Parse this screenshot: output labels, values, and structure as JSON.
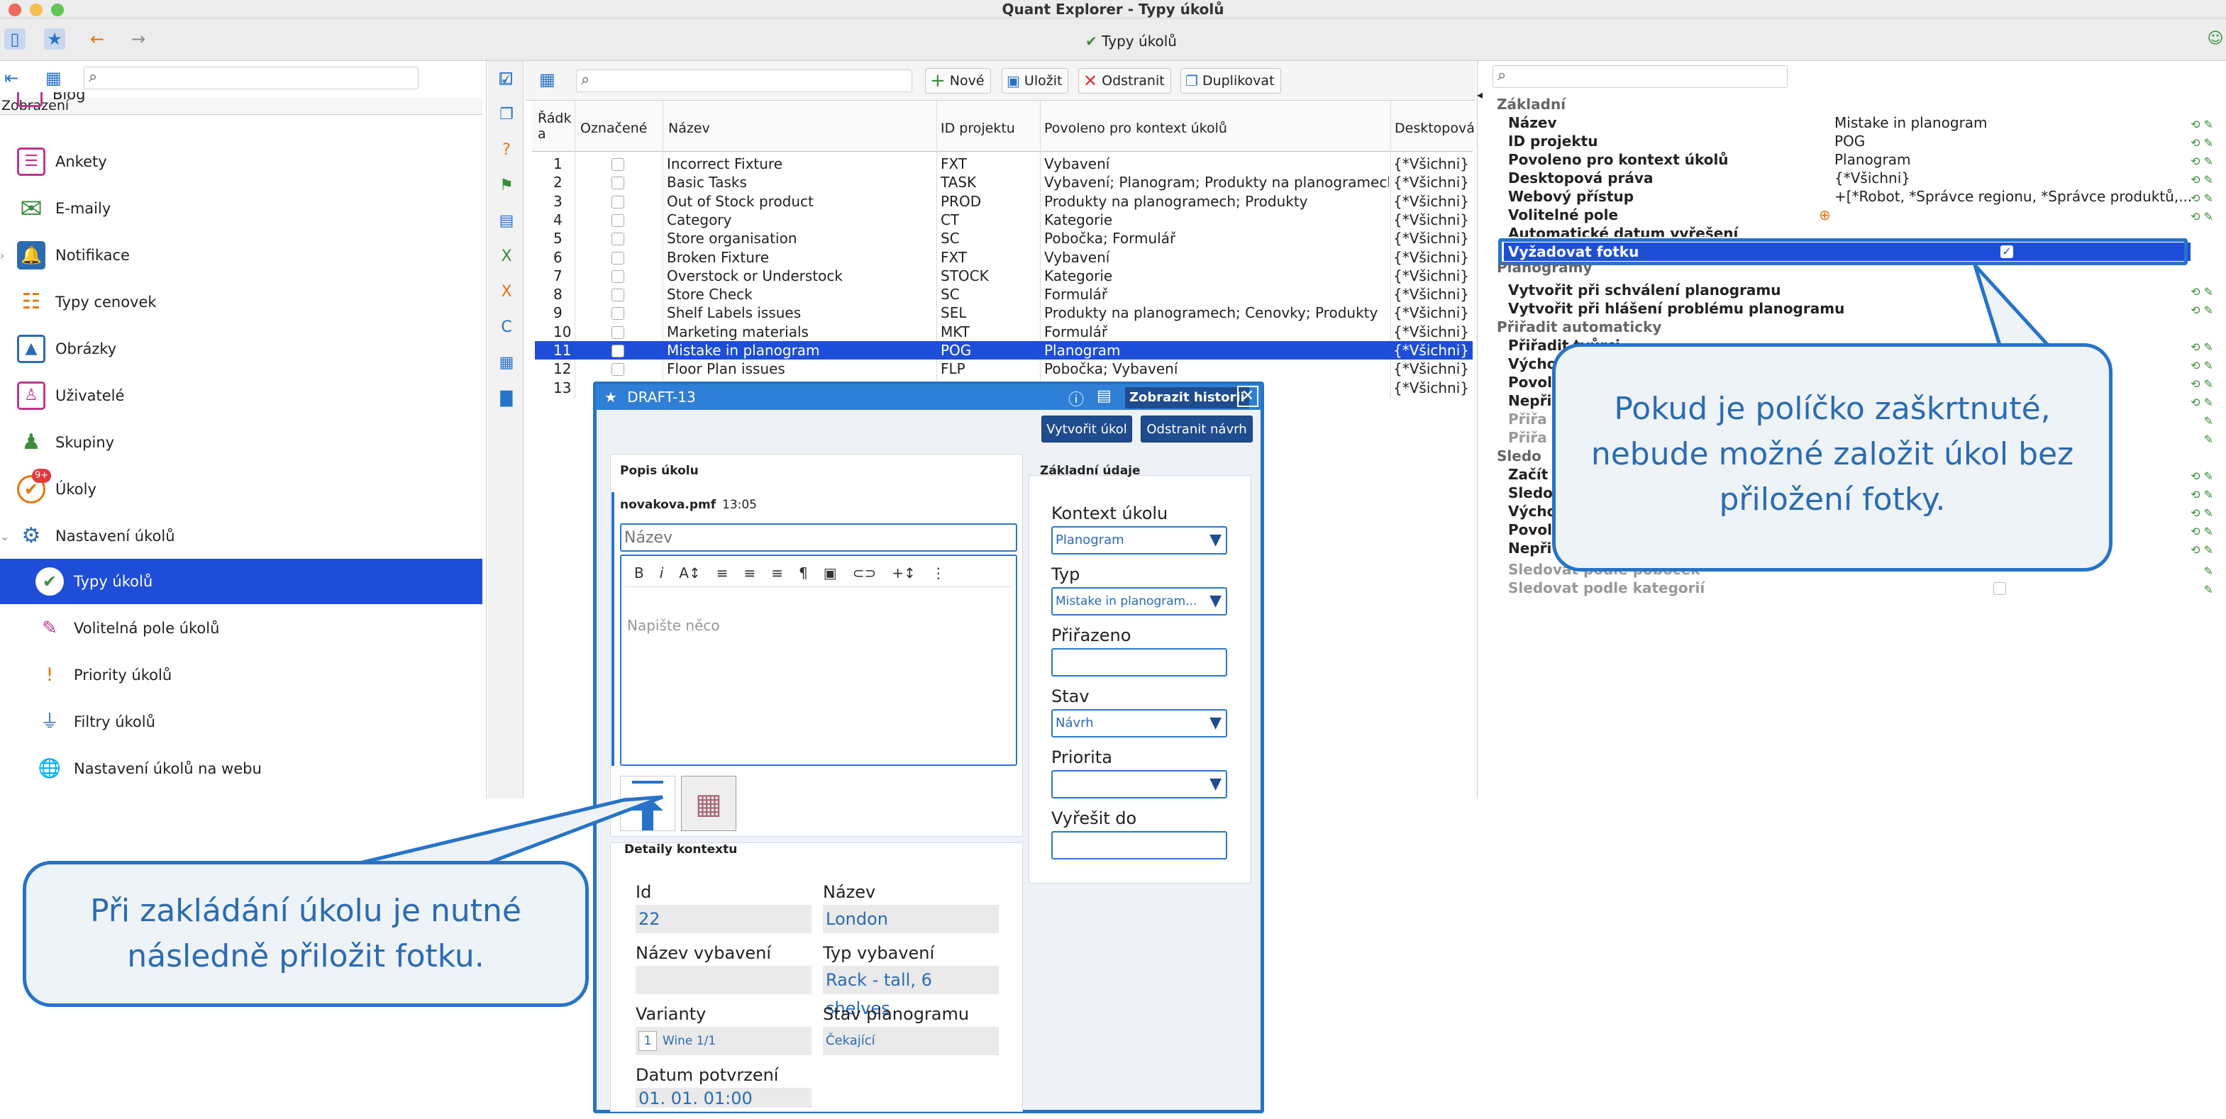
{
  "window": {
    "title": "Quant Explorer - Typy úkolů",
    "center_label": "Typy úkolů"
  },
  "sidebar": {
    "header": "Zobrazení",
    "items": [
      {
        "label": "Blog",
        "icon": "blog-icon"
      },
      {
        "label": "Ankety",
        "icon": "survey-icon"
      },
      {
        "label": "E-maily",
        "icon": "envelope-icon"
      },
      {
        "label": "Notifikace",
        "icon": "bell-icon"
      },
      {
        "label": "Typy cenovek",
        "icon": "price-tag-icon"
      },
      {
        "label": "Obrázky",
        "icon": "image-icon"
      },
      {
        "label": "Uživatelé",
        "icon": "user-icon"
      },
      {
        "label": "Skupiny",
        "icon": "group-icon"
      },
      {
        "label": "Úkoly",
        "icon": "task-icon",
        "badge": "9+"
      },
      {
        "label": "Nastavení úkolů",
        "icon": "task-settings-icon"
      },
      {
        "label": "Typy úkolů",
        "icon": "task-type-icon"
      },
      {
        "label": "Volitelná pole úkolů",
        "icon": "optional-fields-icon"
      },
      {
        "label": "Priority úkolů",
        "icon": "priority-icon"
      },
      {
        "label": "Filtry úkolů",
        "icon": "filter-icon"
      },
      {
        "label": "Nastavení úkolů na webu",
        "icon": "web-settings-icon"
      }
    ]
  },
  "toolbar": {
    "new": "Nové",
    "save": "Uložit",
    "delete": "Odstranit",
    "duplicate": "Duplikovat"
  },
  "table": {
    "headers": [
      "Řádk a",
      "Označené",
      "Název",
      "ID projektu",
      "Povoleno pro kontext úkolů",
      "Desktopová"
    ],
    "rows": [
      {
        "n": "1",
        "name": "Incorrect Fixture",
        "id": "FXT",
        "ctx": "Vybavení",
        "desk": "{*Všichni}"
      },
      {
        "n": "2",
        "name": "Basic Tasks",
        "id": "TASK",
        "ctx": "Vybavení; Planogram; Produkty na planogramech",
        "desk": "{*Všichni}"
      },
      {
        "n": "3",
        "name": "Out of Stock product",
        "id": "PROD",
        "ctx": "Produkty na planogramech; Produkty",
        "desk": "{*Všichni}"
      },
      {
        "n": "4",
        "name": "Category",
        "id": "CT",
        "ctx": "Kategorie",
        "desk": "{*Všichni}"
      },
      {
        "n": "5",
        "name": "Store organisation",
        "id": "SC",
        "ctx": "Pobočka; Formulář",
        "desk": "{*Všichni}"
      },
      {
        "n": "6",
        "name": "Broken Fixture",
        "id": "FXT",
        "ctx": "Vybavení",
        "desk": "{*Všichni}"
      },
      {
        "n": "7",
        "name": "Overstock or Understock",
        "id": "STOCK",
        "ctx": "Kategorie",
        "desk": "{*Všichni}"
      },
      {
        "n": "8",
        "name": "Store Check",
        "id": "SC",
        "ctx": "Formulář",
        "desk": "{*Všichni}"
      },
      {
        "n": "9",
        "name": "Shelf Labels issues",
        "id": "SEL",
        "ctx": "Produkty na planogramech; Cenovky; Produkty",
        "desk": "{*Všichni}"
      },
      {
        "n": "10",
        "name": "Marketing materials",
        "id": "MKT",
        "ctx": "Formulář",
        "desk": "{*Všichni}"
      },
      {
        "n": "11",
        "name": "Mistake in planogram",
        "id": "POG",
        "ctx": "Planogram",
        "desk": "{*Všichni}"
      },
      {
        "n": "12",
        "name": "Floor Plan issues",
        "id": "FLP",
        "ctx": "Pobočka; Vybavení",
        "desk": "{*Všichni}"
      },
      {
        "n": "13",
        "name": "",
        "id": "",
        "ctx": "",
        "desk": "{*Všichni}"
      }
    ]
  },
  "props": {
    "sec_basic": "Základní",
    "name_k": "Název",
    "name_v": "Mistake in planogram",
    "projid_k": "ID projektu",
    "projid_v": "POG",
    "ctx_k": "Povoleno pro kontext úkolů",
    "ctx_v": "Planogram",
    "desk_k": "Desktopová práva",
    "desk_v": "{*Všichni}",
    "web_k": "Webový přístup",
    "web_v": "+[*Robot, *Správce regionu, *Správce produktů,...",
    "opt_k": "Volitelné pole",
    "auto_k": "Automatické datum vyřešení",
    "photo_k": "Vyžadovat fotku",
    "sec_pog": "Planogramy",
    "pog1_k": "Vytvořit při schválení planogramu",
    "pog2_k": "Vytvořit při hlášení problému planogramu",
    "sec_auto": "Přiřadit automaticky",
    "a1": "Přiřadit tvůrci",
    "a2": "Výcho",
    "a3": "Povol",
    "a4": "Nepři",
    "a5": "Přiřa",
    "a6": "Přiřa",
    "sec_track": "Sledo",
    "t1": "Začít",
    "t2": "Sledo",
    "t3": "Výcho",
    "t4": "Povol",
    "t5": "Nepři",
    "t6": "Sledovat podle poboček",
    "t7": "Sledovat podle kategorií"
  },
  "dialog": {
    "title": "DRAFT-13",
    "history": "Zobrazit historii",
    "create": "Vytvořit úkol",
    "remove": "Odstranit návrh",
    "desc_title": "Popis úkolu",
    "author": "novakova.pmf",
    "time": "13:05",
    "name_placeholder": "Název",
    "body_placeholder": "Napište něco",
    "basic_title": "Základní údaje",
    "ctx_label": "Kontext úkolu",
    "ctx_value": "Planogram",
    "type_label": "Typ",
    "type_value": "Mistake in planogram...",
    "assigned_label": "Přiřazeno",
    "state_label": "Stav",
    "state_value": "Návrh",
    "priority_label": "Priorita",
    "resolve_label": "Vyřešit do",
    "ctx_details": "Detaily kontextu",
    "id_label": "Id",
    "id_value": "22",
    "store_label": "Název",
    "store_value": "London",
    "fixture_label": "Název vybavení",
    "fixture_type_label": "Typ vybavení",
    "fixture_type_value": "Rack - tall, 6 shelves",
    "variants_label": "Varianty",
    "variants_count": "1",
    "variants_value": "Wine 1/1",
    "pog_state_label": "Stav planogramu",
    "pog_state_value": "Čekající",
    "confirm_label": "Datum potvrzení",
    "confirm_value": "01. 01. 01:00"
  },
  "callouts": {
    "right": "Pokud je políčko zaškrtnuté, nebude možné založit úkol bez přiložení fotky.",
    "left": "Při zakládání úkolu je nutné následně přiložit fotku."
  },
  "colors": {
    "selection": "#1e4ed8",
    "accent": "#2773c8",
    "dialog_button": "#1f4c8f"
  }
}
